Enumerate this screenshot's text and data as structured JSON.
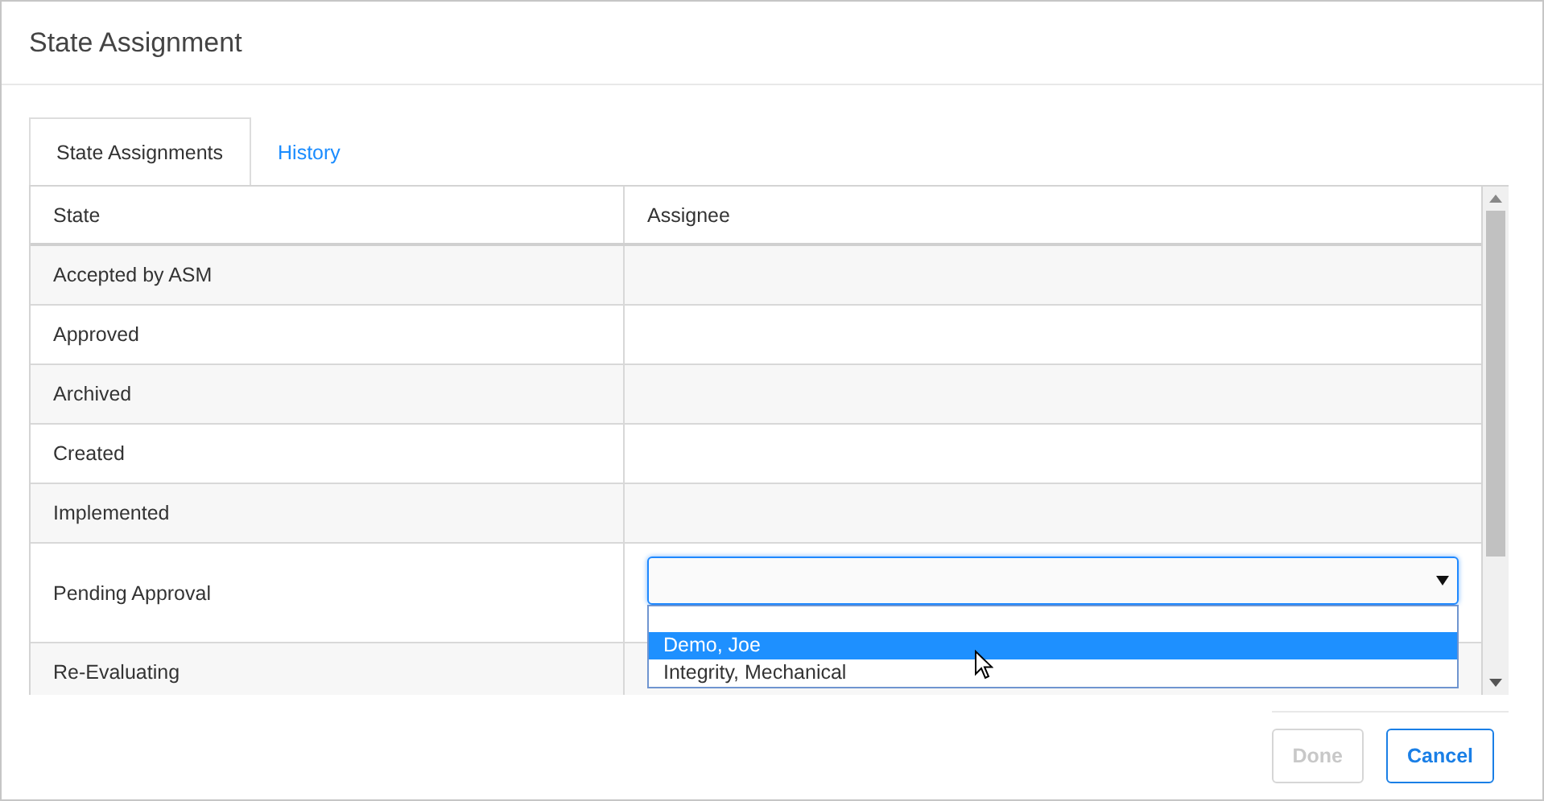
{
  "dialog": {
    "title": "State Assignment"
  },
  "tabs": [
    {
      "label": "State Assignments",
      "selected": true
    },
    {
      "label": "History",
      "selected": false
    }
  ],
  "table": {
    "columns": [
      "State",
      "Assignee"
    ],
    "rows": [
      {
        "state": "Accepted by ASM"
      },
      {
        "state": "Approved"
      },
      {
        "state": "Archived"
      },
      {
        "state": "Created"
      },
      {
        "state": "Implemented"
      },
      {
        "state": "Pending Approval",
        "dropdown": {
          "expanded": true,
          "options": [
            {
              "label": "Demo, Joe",
              "selected": true
            },
            {
              "label": "Integrity, Mechanical",
              "selected": false
            }
          ]
        }
      },
      {
        "state": "Re-Evaluating"
      }
    ]
  },
  "buttons": [
    {
      "label": "Done",
      "disabled": true
    },
    {
      "label": "Cancel",
      "disabled": false
    }
  ]
}
